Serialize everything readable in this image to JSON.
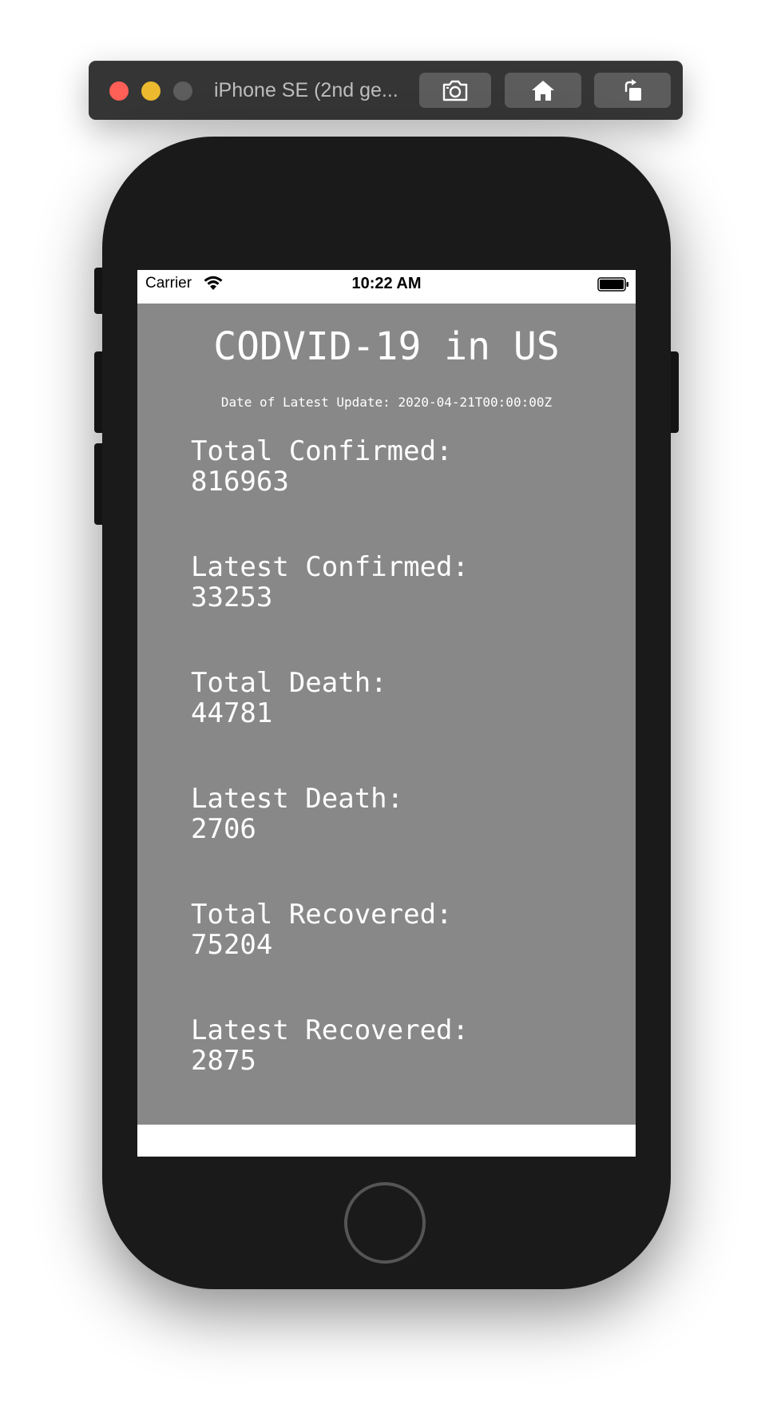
{
  "window": {
    "title": "iPhone SE (2nd ge...",
    "buttons": {
      "screenshot": "camera-icon",
      "home": "home-icon",
      "rotate": "rotate-icon"
    }
  },
  "statusbar": {
    "carrier": "Carrier",
    "time": "10:22 AM"
  },
  "app": {
    "title": "CODVID-19 in US",
    "update_label": "Date of Latest Update: 2020-04-21T00:00:00Z",
    "stats": [
      {
        "label": "Total Confirmed:",
        "value": "816963"
      },
      {
        "label": "Latest Confirmed:",
        "value": "33253"
      },
      {
        "label": "Total Death:",
        "value": "44781"
      },
      {
        "label": "Latest Death:",
        "value": "2706"
      },
      {
        "label": "Total Recovered:",
        "value": "75204"
      },
      {
        "label": "Latest Recovered:",
        "value": "2875"
      }
    ]
  },
  "colors": {
    "content_background": "#888888",
    "text": "#ffffff",
    "device_body": "#1a1a1a",
    "toolbar": "#353535"
  }
}
